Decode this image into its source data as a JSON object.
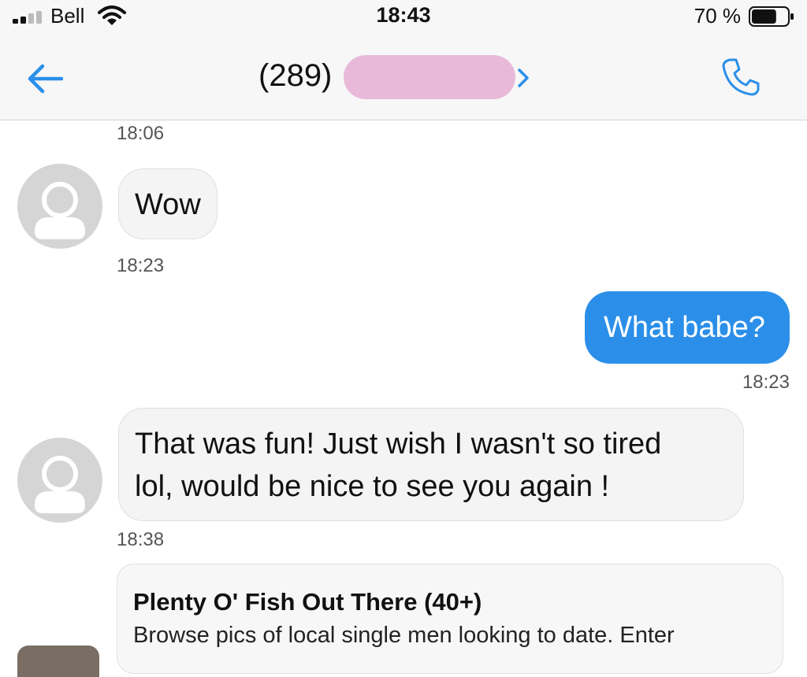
{
  "status_bar": {
    "carrier": "Bell",
    "time": "18:43",
    "battery_percent": "70 %",
    "battery_level": 0.7
  },
  "header": {
    "contact_number": "(289)"
  },
  "messages": [
    {
      "timestamp": "18:06"
    },
    {
      "direction": "incoming",
      "text": "Wow",
      "timestamp": "18:23"
    },
    {
      "direction": "outgoing",
      "text": "What babe?",
      "timestamp": "18:23"
    },
    {
      "direction": "incoming",
      "text_lines": [
        "That was fun! Just wish I wasn't so tired",
        "lol, would be nice to see you again !"
      ],
      "timestamp": "18:38"
    }
  ],
  "link_preview": {
    "title": "Plenty O' Fish Out There (40+)",
    "description": "Browse pics of local single men looking to date. Enter"
  },
  "colors": {
    "accent": "#2b8fe9",
    "incoming_bubble": "#f4f4f4",
    "redaction": "#e8b9d9"
  }
}
